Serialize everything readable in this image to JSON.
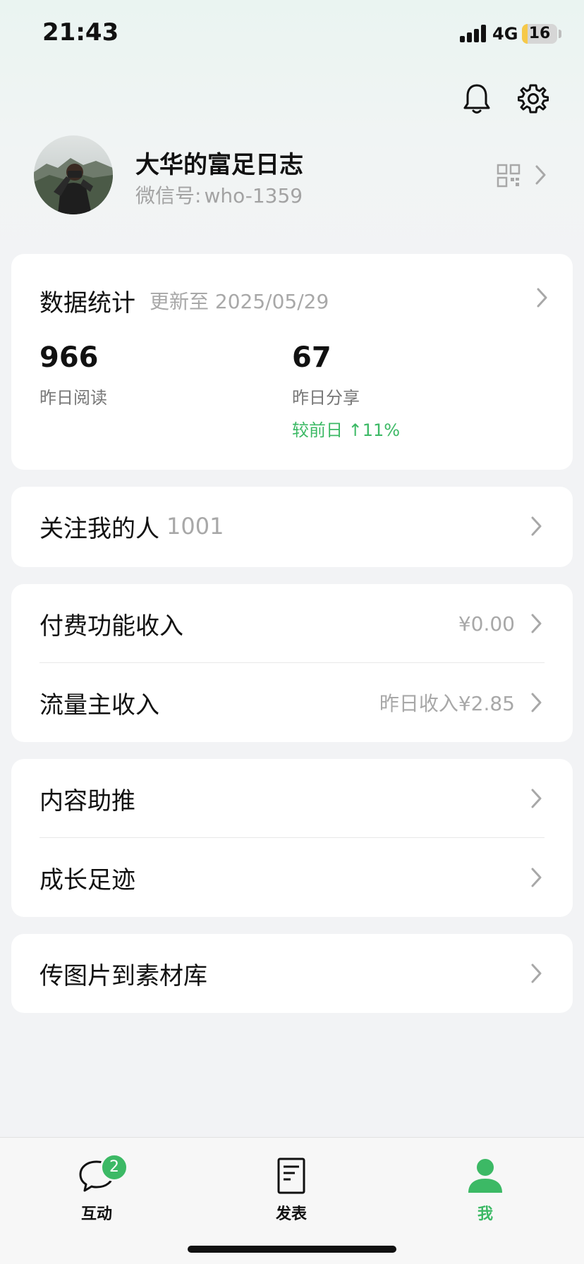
{
  "status_bar": {
    "time": "21:43",
    "network": "4G",
    "battery": "16",
    "battery_level": 0.16
  },
  "profile": {
    "name": "大华的富足日志",
    "id_label": "微信号:",
    "id_value": "who-1359"
  },
  "stats": {
    "title": "数据统计",
    "updated": "更新至 2025/05/29",
    "reads_value": "966",
    "reads_label": "昨日阅读",
    "shares_value": "67",
    "shares_label": "昨日分享",
    "shares_change": "较前日 ↑11%"
  },
  "followers": {
    "title": "关注我的人",
    "count": "1001"
  },
  "income": {
    "paid_title": "付费功能收入",
    "paid_value": "¥0.00",
    "traffic_title": "流量主收入",
    "traffic_value": "昨日收入¥2.85"
  },
  "tools": {
    "promote_title": "内容助推",
    "growth_title": "成长足迹"
  },
  "upload": {
    "title": "传图片到素材库"
  },
  "tabbar": {
    "interact_label": "互动",
    "interact_badge": "2",
    "publish_label": "发表",
    "me_label": "我"
  },
  "colors": {
    "accent": "#3cb965",
    "background": "#f2f3f5",
    "card": "#ffffff"
  },
  "icons": [
    "bell-icon",
    "gear-icon",
    "qr-code-icon",
    "chevron-right-icon",
    "chat-bubble-icon",
    "document-icon",
    "person-icon"
  ]
}
